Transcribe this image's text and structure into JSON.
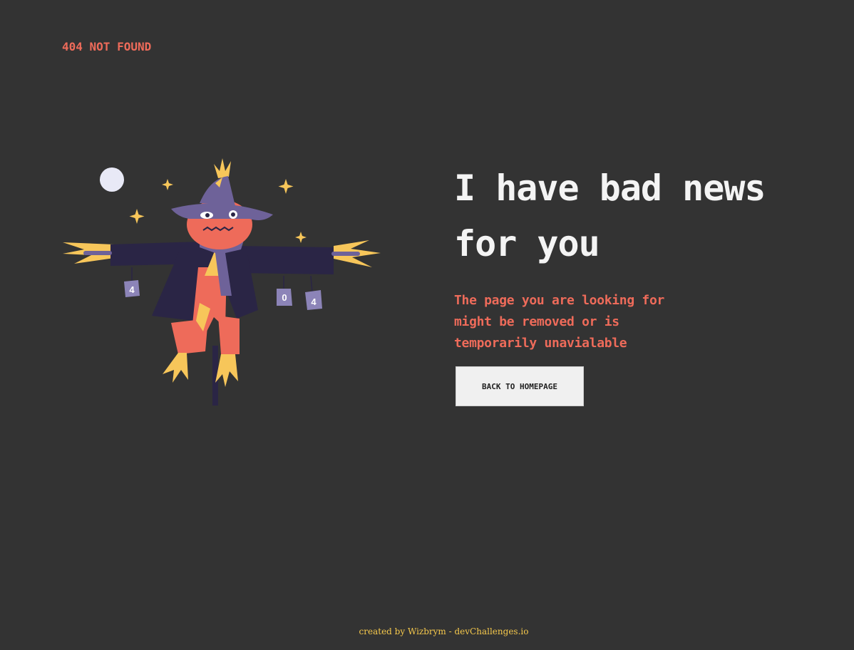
{
  "brand": {
    "label": "404 NOT FOUND"
  },
  "main": {
    "headline": "I have bad news for you",
    "subtext": "The page you are looking for might be removed or is temporarily unavialable",
    "cta_label": "BACK TO HOMEPAGE"
  },
  "illustration": {
    "can_labels": [
      "4",
      "0",
      "4"
    ]
  },
  "footer": {
    "credit": "created by Wizbrym - devChallenges.io"
  },
  "colors": {
    "background": "#333333",
    "accent": "#ee6b5a",
    "heading": "#f4f4f4",
    "button_bg": "#f0f0f0",
    "footer_text": "#f5c84c"
  }
}
